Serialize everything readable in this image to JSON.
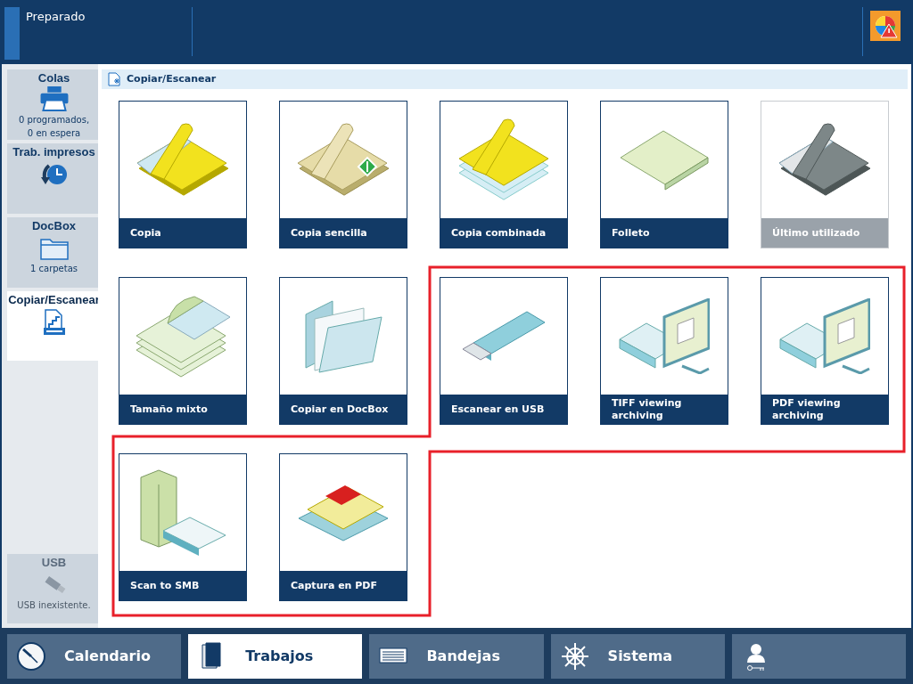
{
  "status_bar": {
    "status": "Preparado"
  },
  "sidebar": {
    "items": [
      {
        "label": "Colas",
        "details": [
          "0 programados,",
          "0 en espera"
        ],
        "selected": false,
        "disabled": false
      },
      {
        "label": "Trab. impresos",
        "selected": false,
        "disabled": false
      },
      {
        "label": "DocBox",
        "details": [
          "1 carpetas"
        ],
        "selected": false,
        "disabled": false
      },
      {
        "label": "Copiar/Escanear",
        "selected": true,
        "disabled": false
      }
    ],
    "bottom_item": {
      "label": "USB",
      "details": [
        "USB inexistente."
      ],
      "selected": false,
      "disabled": true
    }
  },
  "section": {
    "title": "Copiar/Escanear"
  },
  "tiles": [
    {
      "label": "Copia",
      "kind": "copy",
      "disabled": false
    },
    {
      "label": "Copia sencilla",
      "kind": "copy-single",
      "disabled": false
    },
    {
      "label": "Copia combinada",
      "kind": "copy-combined",
      "disabled": false
    },
    {
      "label": "Folleto",
      "kind": "booklet",
      "disabled": false
    },
    {
      "label": "Último utilizado",
      "kind": "copy",
      "disabled": true
    },
    {
      "label": "Tamaño mixto",
      "kind": "mixed",
      "disabled": false
    },
    {
      "label": "Copiar en DocBox",
      "kind": "folder",
      "disabled": false
    },
    {
      "label": "Escanear en USB",
      "kind": "usb",
      "disabled": false
    },
    {
      "label": "TIFF viewing archiving",
      "kind": "scan-monitor",
      "disabled": false
    },
    {
      "label": "PDF viewing archiving",
      "kind": "scan-monitor",
      "disabled": false
    },
    {
      "label": "Scan to SMB",
      "kind": "server",
      "disabled": false
    },
    {
      "label": "Captura en PDF",
      "kind": "pdf",
      "disabled": false
    }
  ],
  "nav": [
    {
      "label": "Calendario",
      "selected": false
    },
    {
      "label": "Trabajos",
      "selected": true
    },
    {
      "label": "Bandejas",
      "selected": false
    },
    {
      "label": "Sistema",
      "selected": false
    },
    {
      "selected": false
    }
  ]
}
